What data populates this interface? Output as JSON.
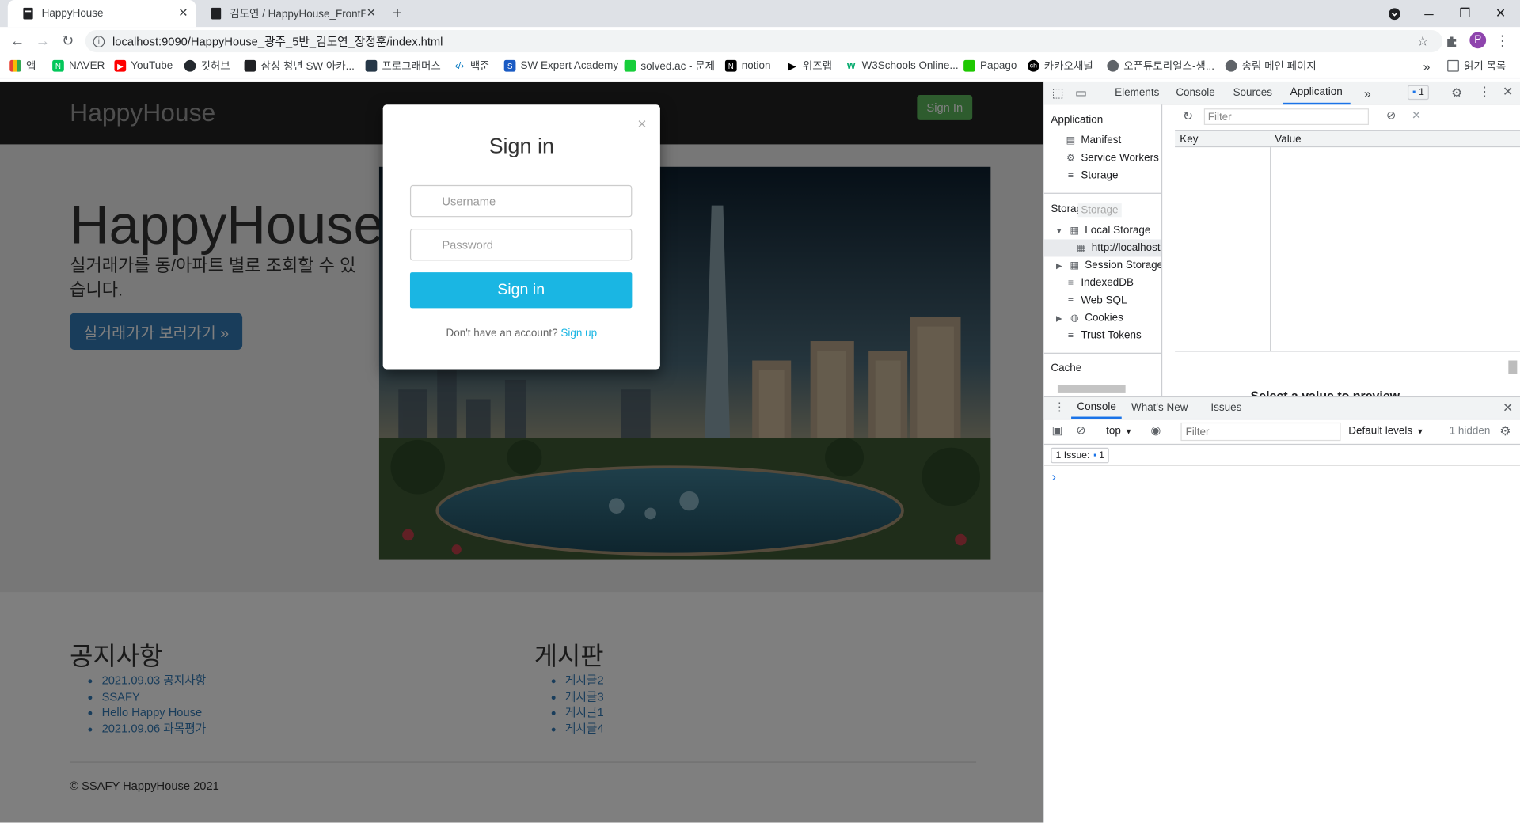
{
  "browser": {
    "tabs": [
      {
        "title": "HappyHouse"
      },
      {
        "title": "김도연 / HappyHouse_FrontEnd"
      }
    ],
    "new_tab": "+",
    "url": "localhost:9090/HappyHouse_광주_5반_김도연_장정훈/index.html",
    "profile_initial": "P",
    "bookmarks": [
      "앱",
      "NAVER",
      "YouTube",
      "깃허브",
      "삼성 청년 SW 아카...",
      "프로그래머스",
      "백준",
      "SW Expert Academy",
      "solved.ac - 문제",
      "notion",
      "위즈랩",
      "W3Schools Online...",
      "Papago",
      "카카오채널",
      "오픈튜토리얼스-생...",
      "송림 메인 페이지"
    ],
    "reading_list": "읽기 목록"
  },
  "page": {
    "brand": "HappyHouse",
    "signin_nav": "Sign In",
    "hero_title": "HappyHouse",
    "hero_subtitle": "실거래가를 동/아파트 별로 조회할 수 있습니다.",
    "hero_button": "실거래가가 보러가기 »",
    "notice": {
      "heading": "공지사항",
      "items": [
        "2021.09.03 공지사항",
        "SSAFY",
        "Hello Happy House",
        "2021.09.06 과목평가"
      ]
    },
    "board": {
      "heading": "게시판",
      "items": [
        "게시글2",
        "게시글3",
        "게시글1",
        "게시글4"
      ]
    },
    "footer": "© SSAFY HappyHouse 2021"
  },
  "modal": {
    "close": "×",
    "title": "Sign in",
    "username_placeholder": "Username",
    "password_placeholder": "Password",
    "submit": "Sign in",
    "footer_text": "Don't have an account?",
    "footer_link": "Sign up"
  },
  "devtools": {
    "tabs": [
      "Elements",
      "Console",
      "Sources",
      "Application",
      "»"
    ],
    "issue_count": "1",
    "sidebar": {
      "application_heading": "Application",
      "application_items": [
        "Manifest",
        "Service Workers",
        "Storage"
      ],
      "storage_heading": "Storage",
      "storage_ghost": "Storage",
      "local_storage": "Local Storage",
      "local_origin": "http://localhost",
      "session_storage": "Session Storage",
      "indexeddb": "IndexedDB",
      "websql": "Web SQL",
      "cookies": "Cookies",
      "trust_tokens": "Trust Tokens",
      "cache_heading": "Cache"
    },
    "grid": {
      "filter_placeholder": "Filter",
      "col_key": "Key",
      "col_value": "Value",
      "cut_text": "Select a value to preview"
    },
    "drawer_tabs": [
      "Console",
      "What's New",
      "Issues"
    ],
    "console": {
      "context": "top",
      "filter_placeholder": "Filter",
      "levels": "Default levels",
      "hidden": "1 hidden",
      "issues_label": "1 Issue:",
      "issues_count": "1",
      "prompt": "›"
    }
  },
  "colors": {
    "accent": "#1a73e8",
    "signin_btn": "#1ab6e3",
    "nav_signin": "#5cb85c",
    "hero_btn": "#337ab7"
  }
}
